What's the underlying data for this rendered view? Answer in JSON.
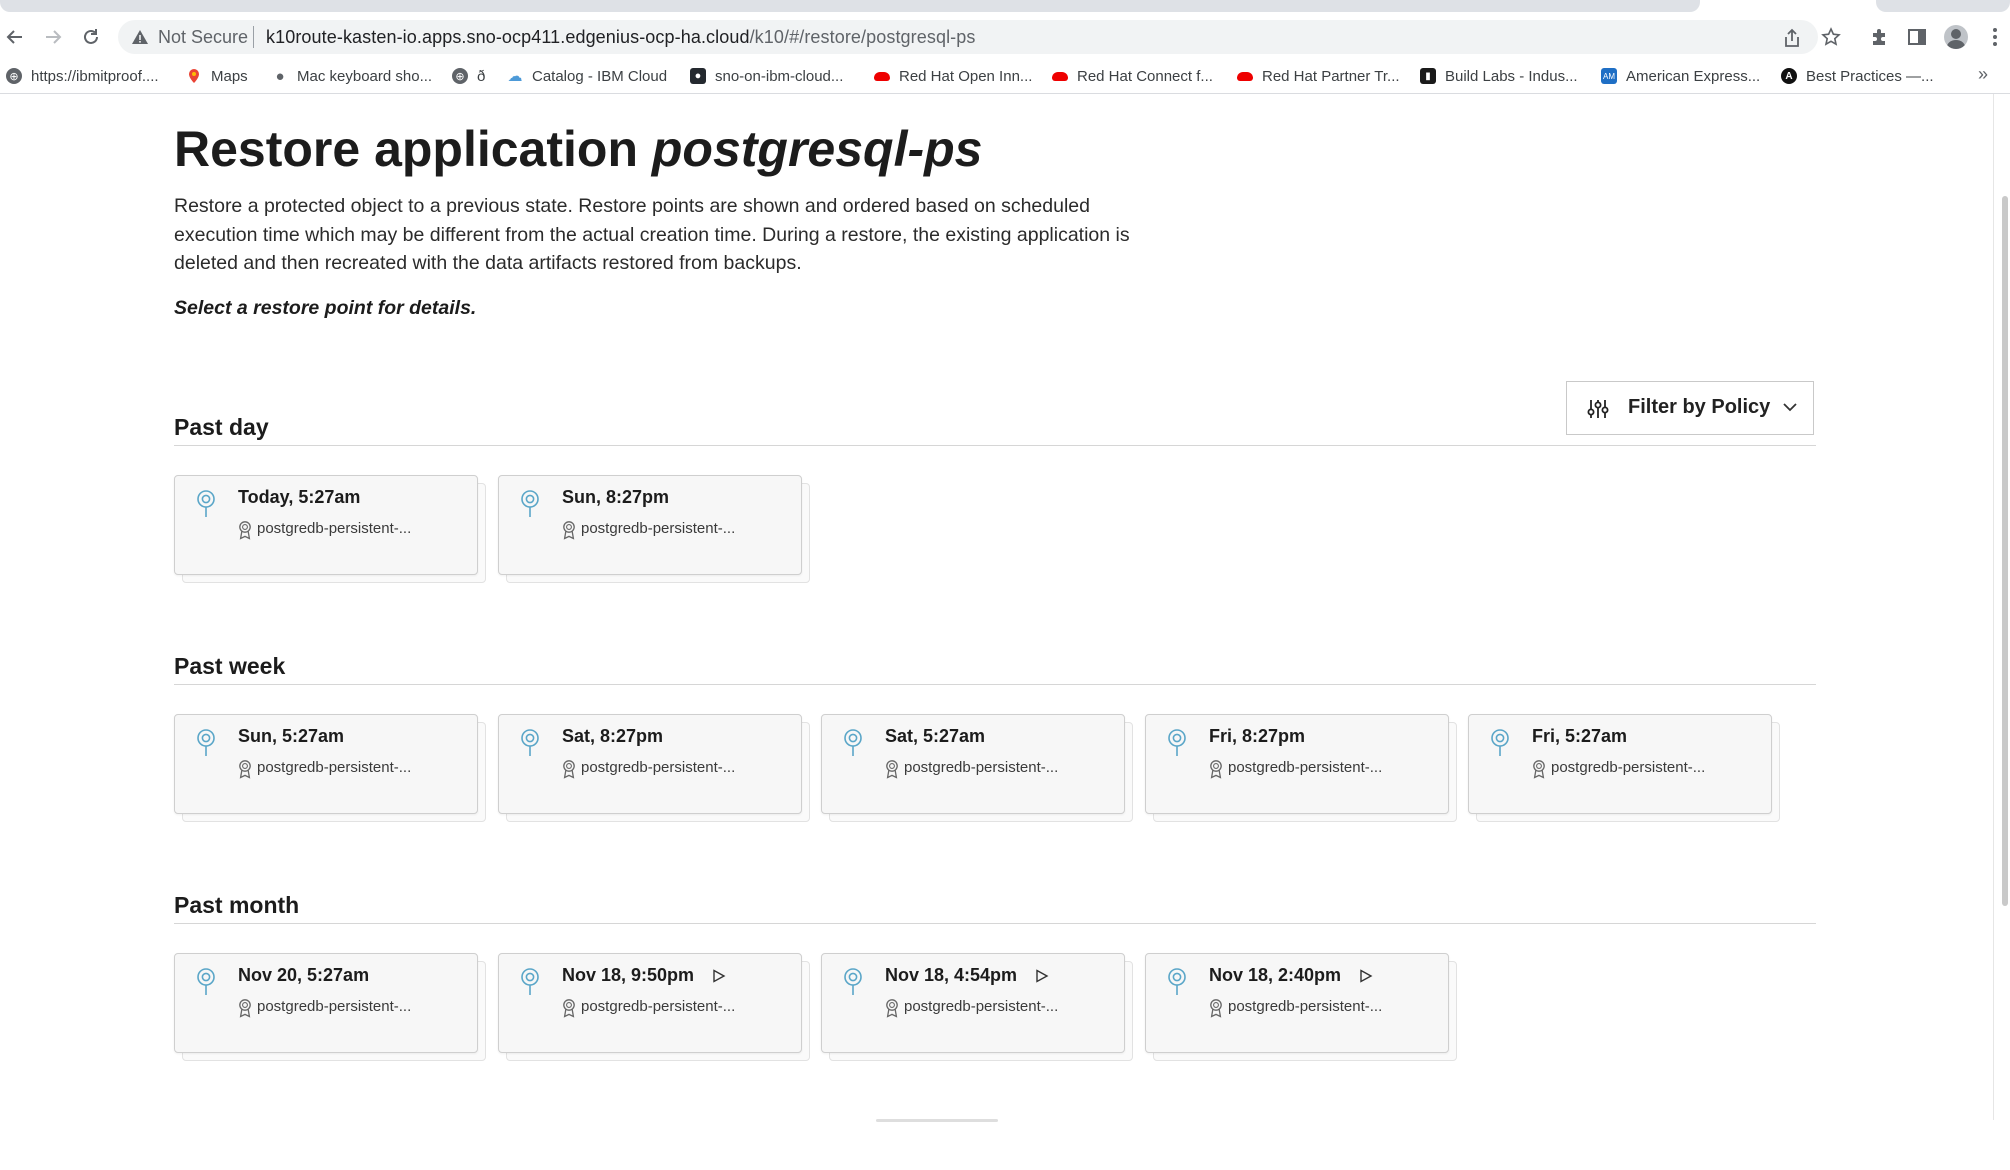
{
  "browser": {
    "security_label": "Not Secure",
    "url_host": "k10route-kasten-io.apps.sno-ocp411.edgenius-ocp-ha.cloud",
    "url_path": "/k10/#/restore/postgresql-ps",
    "bookmarks": [
      {
        "label": "https://ibmitproof....",
        "icon": "globe-icon"
      },
      {
        "label": "Maps",
        "icon": "maps-pin-icon"
      },
      {
        "label": "Mac keyboard sho...",
        "icon": "apple-icon"
      },
      {
        "label": "ð",
        "icon": "globe-icon"
      },
      {
        "label": "Catalog - IBM Cloud",
        "icon": "cloud-icon"
      },
      {
        "label": "sno-on-ibm-cloud...",
        "icon": "github-icon"
      },
      {
        "label": "Red Hat Open Inn...",
        "icon": "redhat-icon"
      },
      {
        "label": "Red Hat Connect f...",
        "icon": "redhat-icon"
      },
      {
        "label": "Red Hat Partner Tr...",
        "icon": "redhat-icon"
      },
      {
        "label": "Build Labs - Indus...",
        "icon": "buildlabs-icon"
      },
      {
        "label": "American Express...",
        "icon": "amex-icon"
      },
      {
        "label": "Best Practices —...",
        "icon": "bestpractices-icon"
      }
    ],
    "more_bookmarks": "»"
  },
  "page": {
    "title_prefix": "Restore application ",
    "title_app": "postgresql-ps",
    "description": "Restore a protected object to a previous state. Restore points are shown and ordered based on scheduled execution time which may be different from the actual creation time. During a restore, the existing application is deleted and then recreated with the data artifacts restored from backups.",
    "hint": "Select a restore point for details.",
    "filter_label": "Filter by Policy"
  },
  "sections": [
    {
      "title": "Past day",
      "cards": [
        {
          "time": "Today, 5:27am",
          "policy": "postgredb-persistent-...",
          "manual": false
        },
        {
          "time": "Sun, 8:27pm",
          "policy": "postgredb-persistent-...",
          "manual": false
        }
      ]
    },
    {
      "title": "Past week",
      "cards": [
        {
          "time": "Sun, 5:27am",
          "policy": "postgredb-persistent-...",
          "manual": false
        },
        {
          "time": "Sat, 8:27pm",
          "policy": "postgredb-persistent-...",
          "manual": false
        },
        {
          "time": "Sat, 5:27am",
          "policy": "postgredb-persistent-...",
          "manual": false
        },
        {
          "time": "Fri, 8:27pm",
          "policy": "postgredb-persistent-...",
          "manual": false
        },
        {
          "time": "Fri, 5:27am",
          "policy": "postgredb-persistent-...",
          "manual": false
        }
      ]
    },
    {
      "title": "Past month",
      "cards": [
        {
          "time": "Nov 20, 5:27am",
          "policy": "postgredb-persistent-...",
          "manual": false
        },
        {
          "time": "Nov 18, 9:50pm",
          "policy": "postgredb-persistent-...",
          "manual": true
        },
        {
          "time": "Nov 18, 4:54pm",
          "policy": "postgredb-persistent-...",
          "manual": true
        },
        {
          "time": "Nov 18, 2:40pm",
          "policy": "postgredb-persistent-...",
          "manual": true
        }
      ]
    }
  ],
  "colors": {
    "pin_accent": "#5aa6c8",
    "card_background": "#f7f7f7",
    "card_border": "#cfcfcf"
  }
}
